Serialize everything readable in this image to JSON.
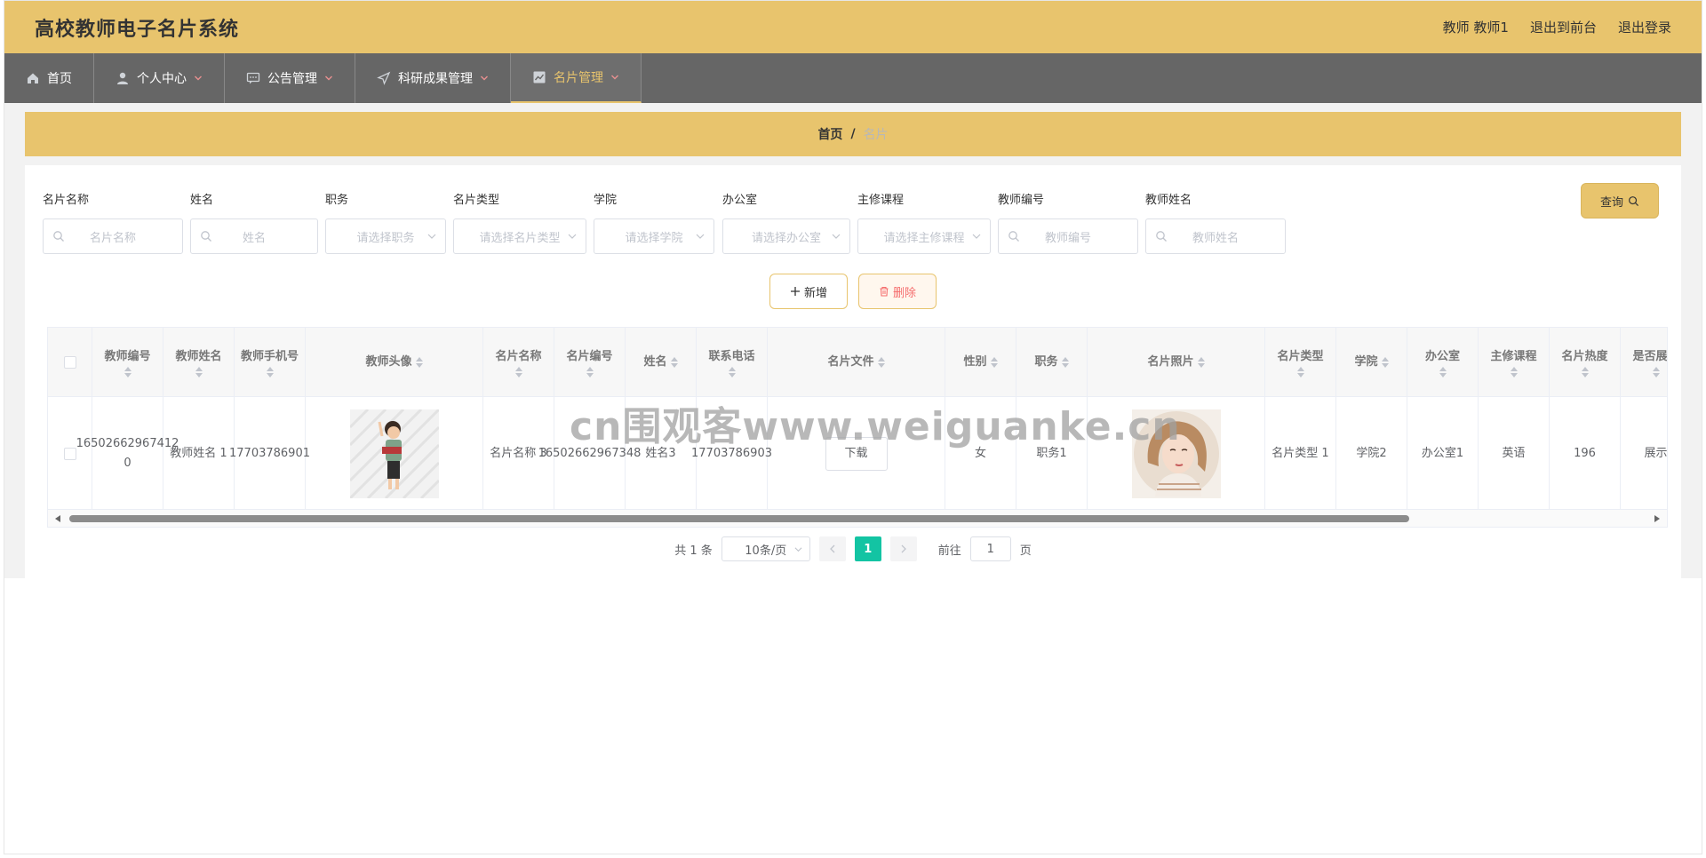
{
  "header": {
    "title": "高校教师电子名片系统",
    "user": "教师 教师1",
    "to_front": "退出到前台",
    "logout": "退出登录"
  },
  "nav": {
    "items": [
      {
        "label": "首页",
        "icon": "home-icon"
      },
      {
        "label": "个人中心",
        "icon": "user-icon"
      },
      {
        "label": "公告管理",
        "icon": "message-icon"
      },
      {
        "label": "科研成果管理",
        "icon": "send-icon"
      },
      {
        "label": "名片管理",
        "icon": "chart-icon",
        "active": true
      }
    ]
  },
  "breadcrumb": {
    "home": "首页",
    "sep": "/",
    "current": "名片"
  },
  "filters": {
    "card_name": {
      "label": "名片名称",
      "placeholder": "名片名称"
    },
    "name": {
      "label": "姓名",
      "placeholder": "姓名"
    },
    "position": {
      "label": "职务",
      "placeholder": "请选择职务"
    },
    "card_type": {
      "label": "名片类型",
      "placeholder": "请选择名片类型"
    },
    "college": {
      "label": "学院",
      "placeholder": "请选择学院"
    },
    "office": {
      "label": "办公室",
      "placeholder": "请选择办公室"
    },
    "course": {
      "label": "主修课程",
      "placeholder": "请选择主修课程"
    },
    "teacher_no": {
      "label": "教师编号",
      "placeholder": "教师编号"
    },
    "teacher_name": {
      "label": "教师姓名",
      "placeholder": "教师姓名"
    },
    "query_label": "查询"
  },
  "actions": {
    "add_label": "新增",
    "delete_label": "删除"
  },
  "table": {
    "headers": {
      "teacher_no": "教师编号",
      "teacher_name": "教师姓名",
      "teacher_phone": "教师手机号",
      "avatar": "教师头像",
      "card_name": "名片名称",
      "card_no": "名片编号",
      "name": "姓名",
      "phone": "联系电话",
      "card_file": "名片文件",
      "gender": "性别",
      "position": "职务",
      "card_photo": "名片照片",
      "card_type": "名片类型",
      "college": "学院",
      "office": "办公室",
      "course": "主修课程",
      "heat": "名片热度",
      "show": "是否展示"
    },
    "rows": [
      {
        "teacher_no": "16502662967412 0",
        "teacher_name": "教师姓名 1",
        "teacher_phone": "17703786901",
        "card_name": "名片名称 3",
        "card_no": "16502662967348",
        "name": "姓名3",
        "phone": "17703786903",
        "download_label": "下载",
        "gender": "女",
        "position": "职务1",
        "card_type": "名片类型 1",
        "college": "学院2",
        "office": "办公室1",
        "course": "英语",
        "heat": "196",
        "show": "展示"
      }
    ]
  },
  "pagination": {
    "total": "共 1 条",
    "page_size": "10条/页",
    "current": "1",
    "goto_label": "前往",
    "goto_value": "1",
    "page_unit": "页"
  },
  "watermark": "cn围观客www.weiguanke.cn",
  "colors": {
    "accent": "#e8c46d",
    "nav_bg": "#666666",
    "page_active": "#13c4a3",
    "danger": "#f56c6c"
  }
}
